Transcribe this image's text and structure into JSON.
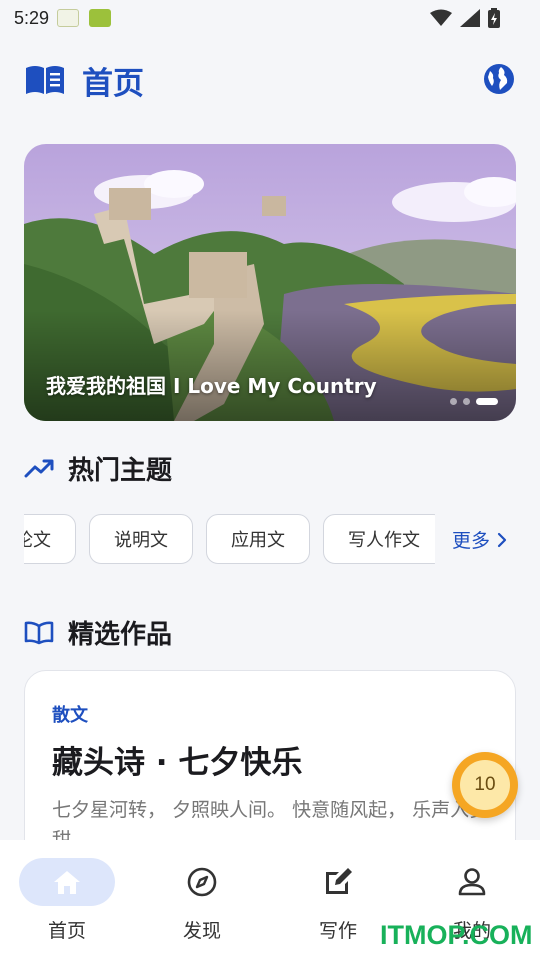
{
  "status_bar": {
    "time": "5:29"
  },
  "header": {
    "title": "首页"
  },
  "banner": {
    "caption": "我爱我的祖国 I Love My Country",
    "slide_count": 3,
    "active_slide": 3
  },
  "hot_topics": {
    "title": "热门主题",
    "chips": [
      "论文",
      "说明文",
      "应用文",
      "写人作文"
    ],
    "more_label": "更多"
  },
  "featured": {
    "title": "精选作品",
    "card": {
      "tag": "散文",
      "title": "藏头诗 · 七夕快乐",
      "excerpt": "七夕星河转， 夕照映人间。 快意随风起， 乐声入梦甜。"
    }
  },
  "coin_badge": {
    "value": "10"
  },
  "nav": [
    {
      "label": "首页",
      "icon": "home-icon"
    },
    {
      "label": "发现",
      "icon": "compass-icon"
    },
    {
      "label": "写作",
      "icon": "edit-icon"
    },
    {
      "label": "我的",
      "icon": "person-icon"
    }
  ],
  "watermark": "ITMOP.COM",
  "colors": {
    "accent": "#1e4fbf",
    "nav_active_bg": "#dde6fb",
    "coin": "#f5a623",
    "watermark": "#18b15a"
  }
}
